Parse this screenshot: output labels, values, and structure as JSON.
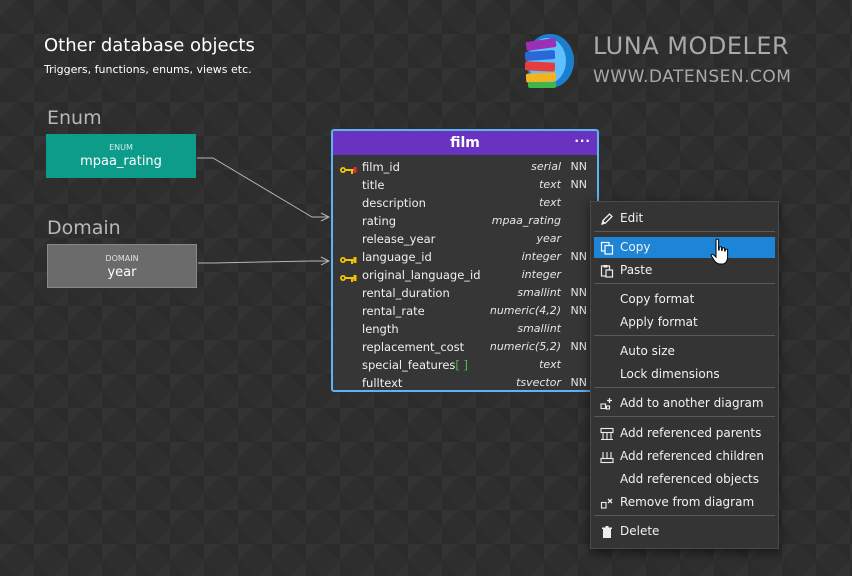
{
  "header": {
    "title": "Other database objects",
    "subtitle": "Triggers, functions, enums, views etc."
  },
  "brand": {
    "name": "LUNA MODELER",
    "url": "WWW.DATENSEN.COM",
    "logo_icon": "books-stack-icon"
  },
  "enum": {
    "section_label": "Enum",
    "kind": "ENUM",
    "name": "mpaa_rating",
    "color": "#0e9c8a"
  },
  "domain": {
    "section_label": "Domain",
    "kind": "DOMAIN",
    "name": "year",
    "color": "#6b6b6b"
  },
  "table": {
    "name": "film",
    "menu_glyph": "···",
    "header_color": "#6a32c0",
    "border_color": "#5fb3ee",
    "columns": [
      {
        "name": "film_id",
        "type": "serial",
        "nn": "NN",
        "key": "pk"
      },
      {
        "name": "title",
        "type": "text",
        "nn": "NN",
        "key": ""
      },
      {
        "name": "description",
        "type": "text",
        "nn": "",
        "key": ""
      },
      {
        "name": "rating",
        "type": "mpaa_rating",
        "nn": "",
        "key": ""
      },
      {
        "name": "release_year",
        "type": "year",
        "nn": "",
        "key": ""
      },
      {
        "name": "language_id",
        "type": "integer",
        "nn": "NN",
        "key": "fk"
      },
      {
        "name": "original_language_id",
        "type": "integer",
        "nn": "",
        "key": "fk"
      },
      {
        "name": "rental_duration",
        "type": "smallint",
        "nn": "NN",
        "key": ""
      },
      {
        "name": "rental_rate",
        "type": "numeric(4,2)",
        "nn": "NN",
        "key": ""
      },
      {
        "name": "length",
        "type": "smallint",
        "nn": "",
        "key": ""
      },
      {
        "name": "replacement_cost",
        "type": "numeric(5,2)",
        "nn": "NN",
        "key": ""
      },
      {
        "name": "special_features",
        "type": "text",
        "nn": "",
        "key": "",
        "array_suffix": "[ ]"
      },
      {
        "name": "fulltext",
        "type": "tsvector",
        "nn": "NN",
        "key": ""
      }
    ]
  },
  "context_menu": {
    "items": [
      {
        "label": "Edit",
        "icon": "pencil-icon"
      },
      {
        "label": "Copy",
        "icon": "copy-icon",
        "selected": true
      },
      {
        "label": "Paste",
        "icon": "paste-icon"
      },
      {
        "label": "Copy format",
        "icon": ""
      },
      {
        "label": "Apply format",
        "icon": ""
      },
      {
        "label": "Auto size",
        "icon": ""
      },
      {
        "label": "Lock dimensions",
        "icon": ""
      },
      {
        "label": "Add to another diagram",
        "icon": "add-to-diagram-icon"
      },
      {
        "label": "Add referenced parents",
        "icon": "referenced-parents-icon"
      },
      {
        "label": "Add referenced children",
        "icon": "referenced-children-icon"
      },
      {
        "label": "Add referenced objects",
        "icon": ""
      },
      {
        "label": "Remove from diagram",
        "icon": "remove-from-diagram-icon"
      },
      {
        "label": "Delete",
        "icon": "trash-icon"
      }
    ],
    "selected_color": "#1e84d6"
  }
}
